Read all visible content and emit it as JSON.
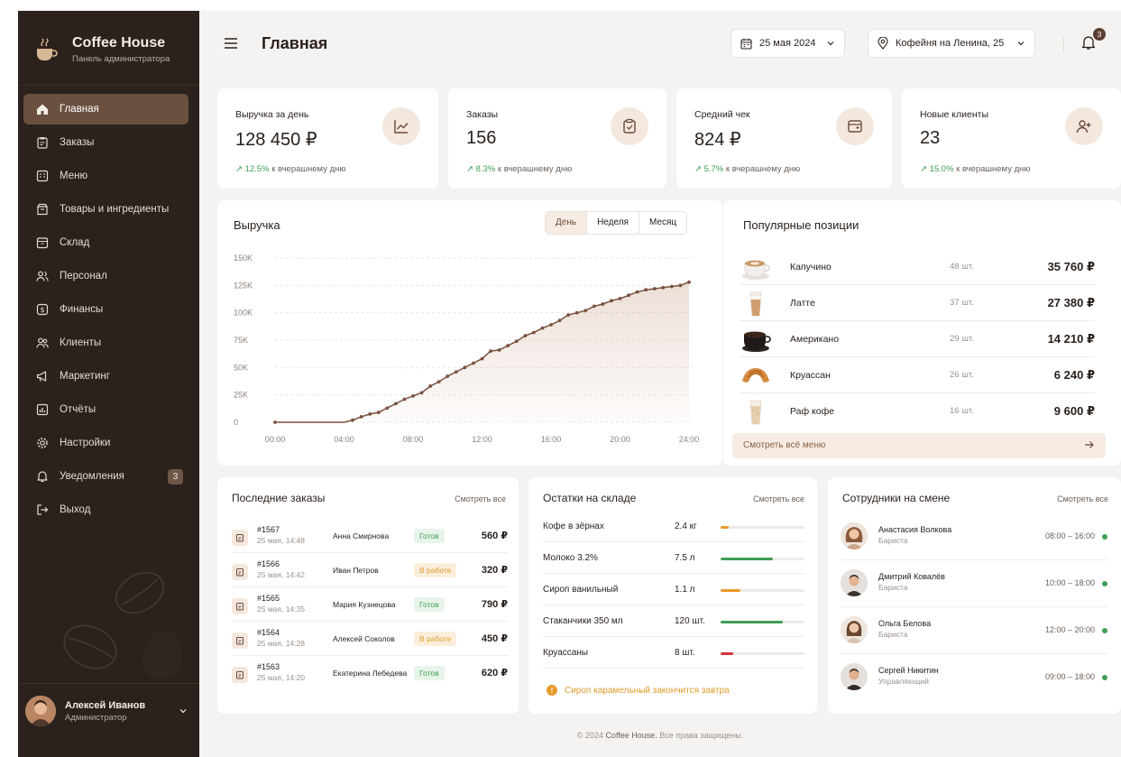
{
  "brand": {
    "title": "Coffee House",
    "subtitle": "Панель администратора"
  },
  "sidebar": {
    "items": [
      {
        "label": "Главная",
        "icon": "home-icon",
        "active": true
      },
      {
        "label": "Заказы",
        "icon": "clipboard-icon"
      },
      {
        "label": "Меню",
        "icon": "menu-book-icon"
      },
      {
        "label": "Товары и ингредиенты",
        "icon": "box-icon"
      },
      {
        "label": "Склад",
        "icon": "warehouse-icon"
      },
      {
        "label": "Персонал",
        "icon": "staff-icon"
      },
      {
        "label": "Финансы",
        "icon": "finance-icon"
      },
      {
        "label": "Клиенты",
        "icon": "clients-icon"
      },
      {
        "label": "Маркетинг",
        "icon": "megaphone-icon"
      },
      {
        "label": "Отчёты",
        "icon": "reports-icon"
      },
      {
        "label": "Настройки",
        "icon": "gear-icon"
      },
      {
        "label": "Уведомления",
        "icon": "bell-icon",
        "badge": "3"
      },
      {
        "label": "Выход",
        "icon": "logout-icon"
      }
    ]
  },
  "user": {
    "name": "Алексей Иванов",
    "role": "Администратор"
  },
  "header": {
    "title": "Главная",
    "date": "25 мая 2024",
    "location": "Кофейня на Ленина, 25",
    "notifications": "3"
  },
  "kpis": [
    {
      "title": "Выручка за день",
      "value": "128 450 ₽",
      "delta": "↗ 12.5%",
      "delta_text": "к вчерашнему дню",
      "icon": "trend-icon"
    },
    {
      "title": "Заказы",
      "value": "156",
      "delta": "↗ 8.3%",
      "delta_text": "к вчерашнему дню",
      "icon": "clipboard-icon"
    },
    {
      "title": "Средний чек",
      "value": "824 ₽",
      "delta": "↗ 5.7%",
      "delta_text": "к вчерашнему дню",
      "icon": "wallet-icon"
    },
    {
      "title": "Новые клиенты",
      "value": "23",
      "delta": "↗ 15.0%",
      "delta_text": "к вчерашнему дню",
      "icon": "user-plus-icon"
    }
  ],
  "revenue": {
    "title": "Выручка",
    "tabs": [
      "День",
      "Неделя",
      "Месяц"
    ],
    "active_tab": "День"
  },
  "chart_data": {
    "type": "area",
    "title": "Выручка",
    "x_ticks": [
      "00:00",
      "04:00",
      "08:00",
      "12:00",
      "16:00",
      "20:00",
      "24:00"
    ],
    "y_ticks": [
      "0",
      "25K",
      "50K",
      "75K",
      "100K",
      "125K",
      "150K"
    ],
    "ylim": [
      0,
      150000
    ],
    "xlim": [
      0,
      24
    ],
    "grid": true,
    "color": "#7a5240",
    "x": [
      0,
      4,
      4.5,
      5,
      5.5,
      6,
      6.5,
      7,
      7.5,
      8,
      8.5,
      9,
      9.5,
      10,
      10.5,
      11,
      11.5,
      12,
      12.5,
      13,
      13.5,
      14,
      14.5,
      15,
      15.5,
      16,
      16.5,
      17,
      17.5,
      18,
      18.5,
      19,
      19.5,
      20,
      20.5,
      21,
      21.5,
      22,
      22.5,
      23,
      23.5,
      24
    ],
    "values": [
      0,
      0,
      2000,
      5000,
      7500,
      9000,
      13000,
      17000,
      21000,
      24000,
      27000,
      33000,
      37000,
      42000,
      46000,
      50000,
      54000,
      58000,
      65000,
      66000,
      70000,
      74000,
      79000,
      82000,
      86000,
      89000,
      93000,
      98000,
      100000,
      102000,
      106000,
      108000,
      111000,
      113000,
      116000,
      119000,
      121000,
      122000,
      123000,
      124000,
      125000,
      128000
    ]
  },
  "popular": {
    "title": "Популярные позиции",
    "items": [
      {
        "name": "Капучино",
        "qty": "48 шт.",
        "price": "35 760 ₽",
        "icon": "cappuccino-icon"
      },
      {
        "name": "Латте",
        "qty": "37 шт.",
        "price": "27 380 ₽",
        "icon": "latte-icon"
      },
      {
        "name": "Американо",
        "qty": "29 шт.",
        "price": "14 210 ₽",
        "icon": "americano-icon"
      },
      {
        "name": "Круассан",
        "qty": "26 шт.",
        "price": "6 240 ₽",
        "icon": "croissant-icon"
      },
      {
        "name": "Раф кофе",
        "qty": "16 шт.",
        "price": "9 600 ₽",
        "icon": "raf-icon"
      }
    ],
    "footer": "Смотреть всё меню"
  },
  "orders": {
    "title": "Последние заказы",
    "link": "Смотреть все",
    "rows": [
      {
        "id": "#1567",
        "time": "25 мая, 14:48",
        "client": "Анна Смирнова",
        "status": "Готов",
        "state": "ready",
        "sum": "560 ₽"
      },
      {
        "id": "#1566",
        "time": "25 мая, 14:42",
        "client": "Иван Петров",
        "status": "В работе",
        "state": "work",
        "sum": "320 ₽"
      },
      {
        "id": "#1565",
        "time": "25 мая, 14:35",
        "client": "Мария Кузнецова",
        "status": "Готов",
        "state": "ready",
        "sum": "790 ₽"
      },
      {
        "id": "#1564",
        "time": "25 мая, 14:28",
        "client": "Алексей Соколов",
        "status": "В работе",
        "state": "work",
        "sum": "450 ₽"
      },
      {
        "id": "#1563",
        "time": "25 мая, 14:20",
        "client": "Екатерина Лебедева",
        "status": "Готов",
        "state": "ready",
        "sum": "620 ₽"
      }
    ]
  },
  "stock": {
    "title": "Остатки на складе",
    "link": "Смотреть все",
    "rows": [
      {
        "name": "Кофе в зёрнах",
        "qty": "2.4 кг",
        "level": 0.1,
        "color": "#e89a2a"
      },
      {
        "name": "Молоко 3.2%",
        "qty": "7.5 л",
        "level": 0.62,
        "color": "#3f9e55"
      },
      {
        "name": "Сироп ванильный",
        "qty": "1.1 л",
        "level": 0.24,
        "color": "#e89a2a"
      },
      {
        "name": "Стаканчики 350 мл",
        "qty": "120 шт.",
        "level": 0.74,
        "color": "#3f9e55"
      },
      {
        "name": "Круассаны",
        "qty": "8 шт.",
        "level": 0.15,
        "color": "#d6333c"
      }
    ],
    "warning": "Сироп карамельный закончится завтра"
  },
  "staff": {
    "title": "Сотрудники на смене",
    "link": "Смотреть все",
    "rows": [
      {
        "name": "Анастасия Волкова",
        "role": "Бариста",
        "time": "08:00 – 16:00"
      },
      {
        "name": "Дмитрий Ковалёв",
        "role": "Бариста",
        "time": "10:00 – 18:00"
      },
      {
        "name": "Ольга Белова",
        "role": "Бариста",
        "time": "12:00 – 20:00"
      },
      {
        "name": "Сергей Никитин",
        "role": "Управляющий",
        "time": "09:00 – 18:00"
      }
    ]
  },
  "footer": {
    "copyright": "© 2024",
    "brand": "Coffee House.",
    "rights": "Все права защищены."
  }
}
